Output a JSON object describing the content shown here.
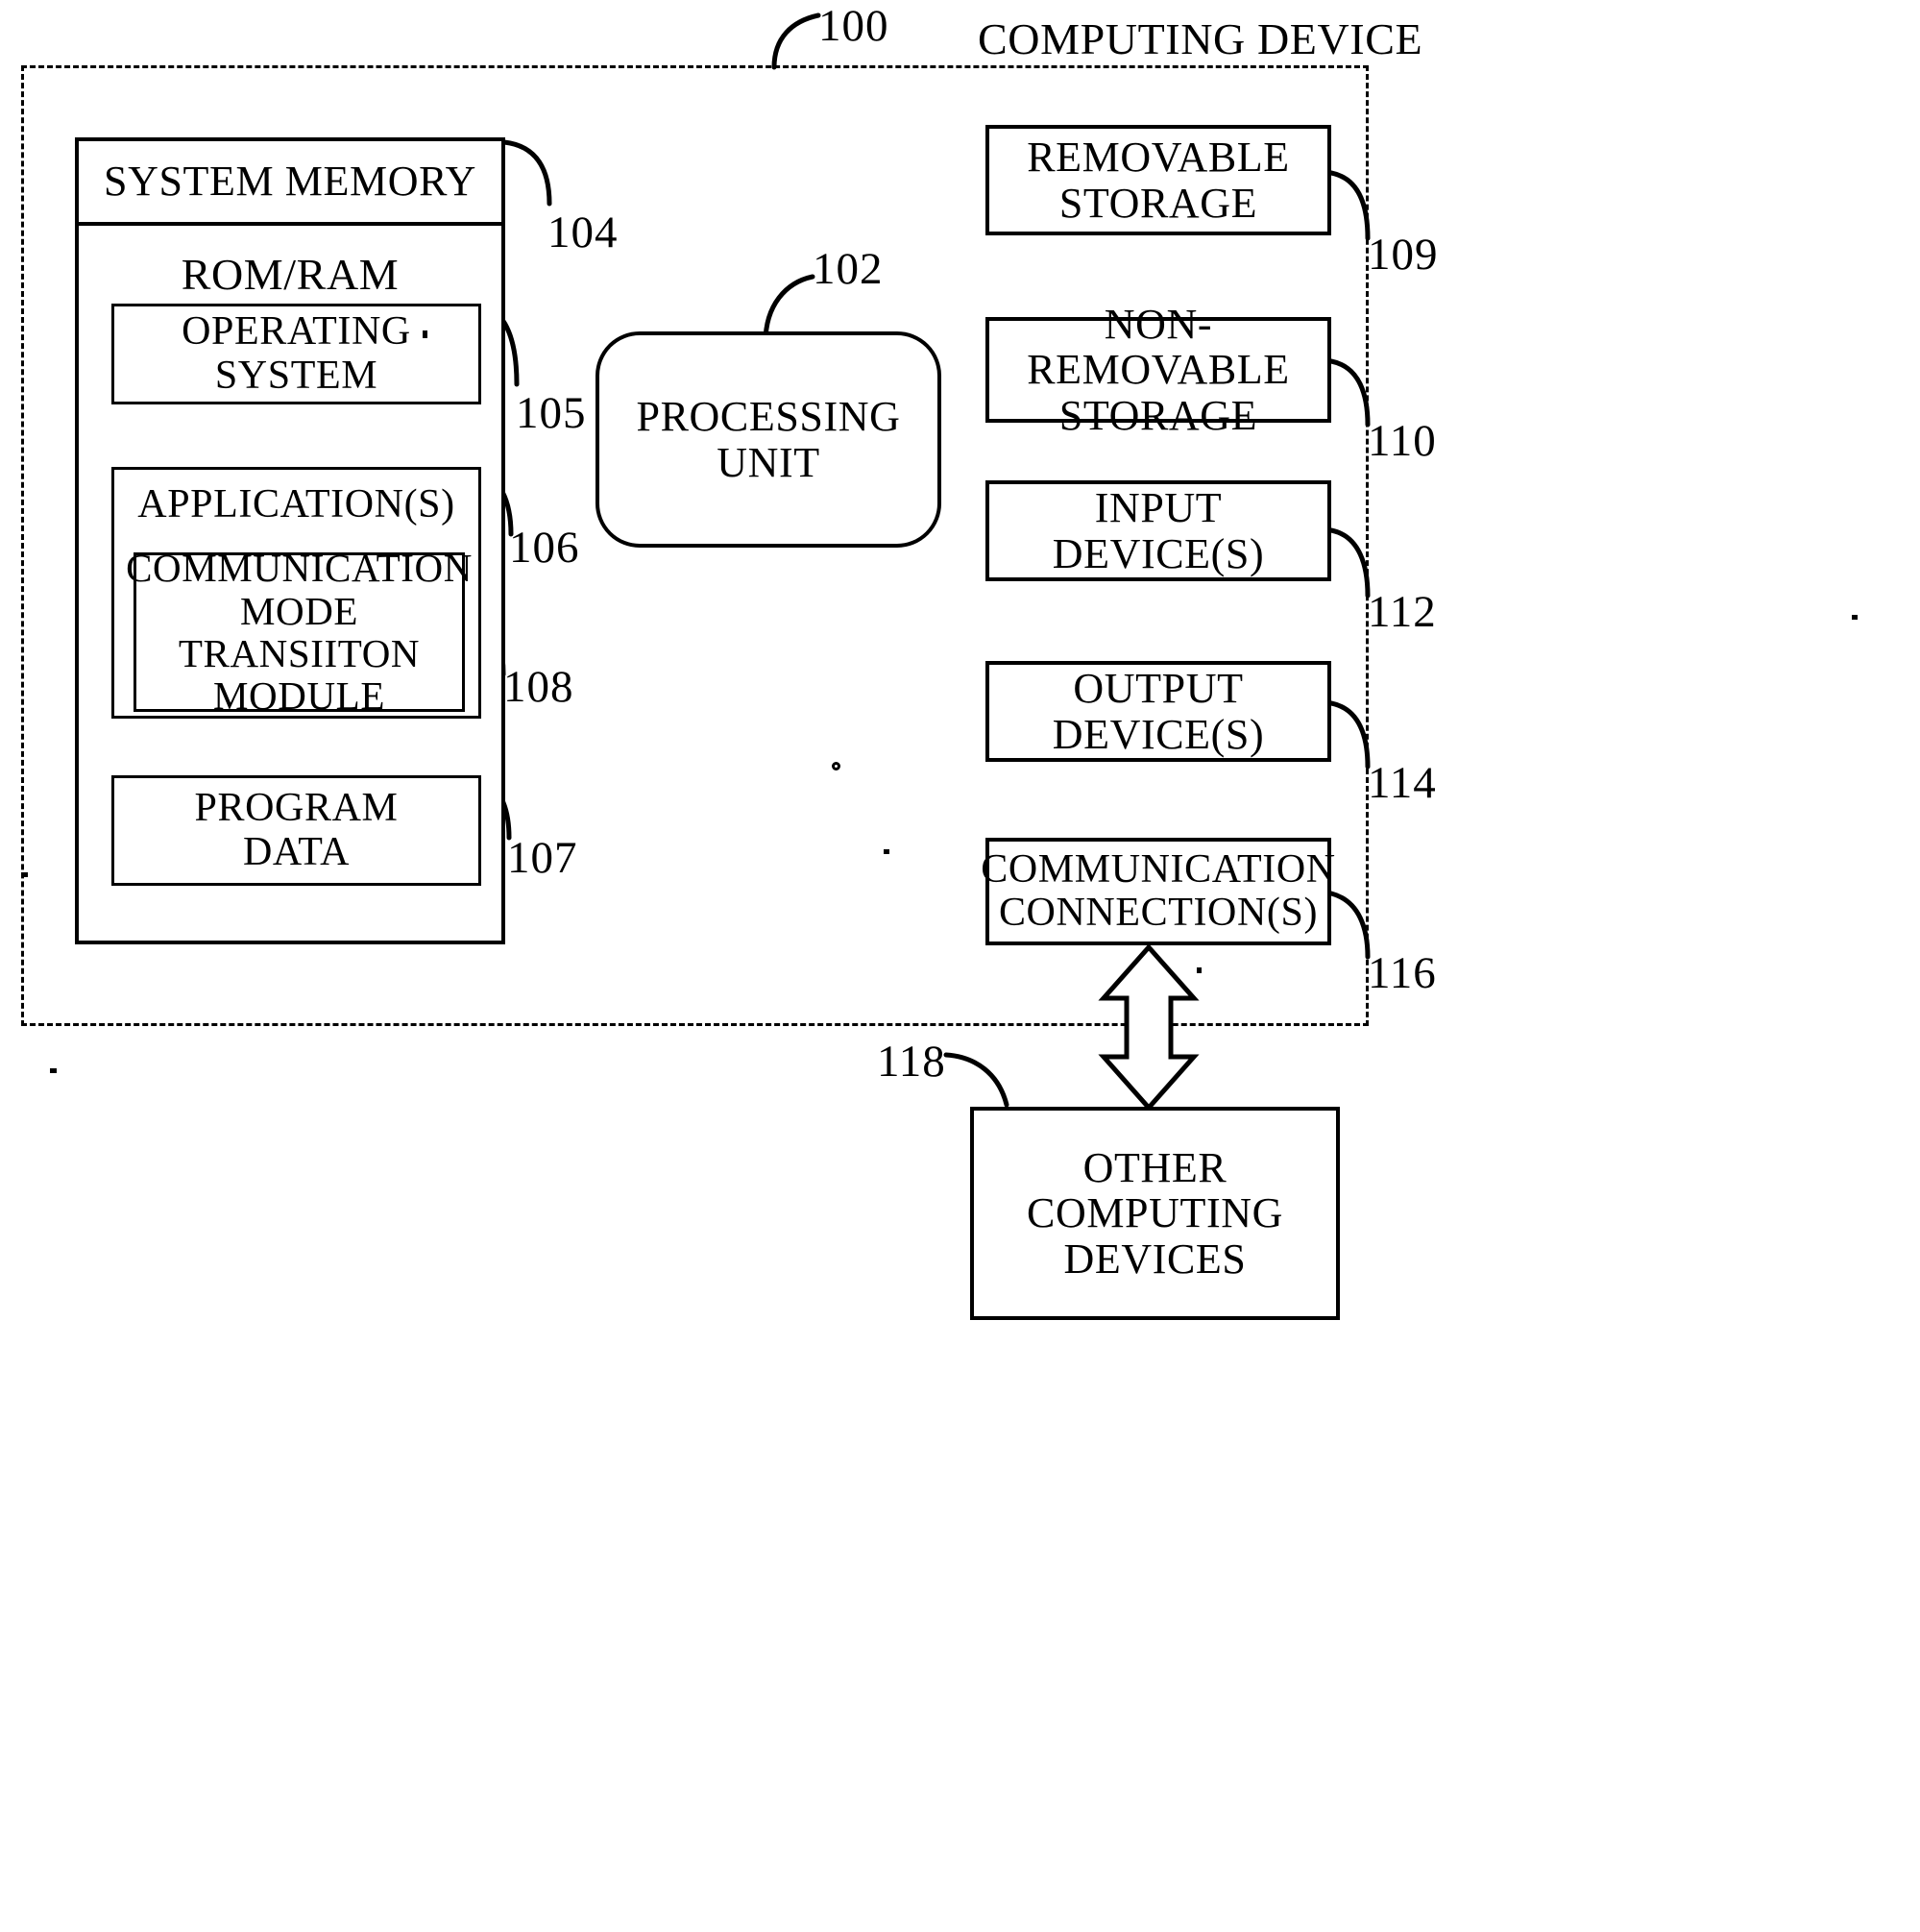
{
  "figure": {
    "title": "COMPUTING DEVICE",
    "root_ref": "100"
  },
  "boundary": {
    "label": "COMPUTING DEVICE",
    "style": "dashed"
  },
  "memory": {
    "header": "SYSTEM MEMORY",
    "header_ref": "104",
    "subheader": "ROM/RAM",
    "blocks": [
      {
        "id": "os",
        "lines": [
          "OPERATING",
          "SYSTEM"
        ],
        "ref": "105"
      },
      {
        "id": "app",
        "lines": [
          "APPLICATION(S)"
        ],
        "ref": "106"
      },
      {
        "id": "module",
        "lines": [
          "COMMUNICATION",
          "MODE TRANSIITON",
          "MODULE"
        ],
        "ref": "108"
      },
      {
        "id": "progdata",
        "lines": [
          "PROGRAM",
          "DATA"
        ],
        "ref": "107"
      }
    ]
  },
  "processing_unit": {
    "label": "PROCESSING UNIT",
    "ref": "102"
  },
  "peripherals": [
    {
      "id": "removable",
      "lines": [
        "REMOVABLE",
        "STORAGE"
      ],
      "ref": "109"
    },
    {
      "id": "non-removable",
      "lines": [
        "NON-REMOVABLE",
        "STORAGE"
      ],
      "ref": "110"
    },
    {
      "id": "input",
      "lines": [
        "INPUT DEVICE(S)"
      ],
      "ref": "112"
    },
    {
      "id": "output",
      "lines": [
        "OUTPUT DEVICE(S)"
      ],
      "ref": "114"
    },
    {
      "id": "comm",
      "lines": [
        "COMMUNICATION",
        "CONNECTION(S)"
      ],
      "ref": "116"
    }
  ],
  "external": {
    "lines": [
      "OTHER",
      "COMPUTING",
      "DEVICES"
    ],
    "ref": "118",
    "connector": "double-headed-vertical-arrow"
  },
  "colors": {
    "ink": "#000000",
    "paper": "#ffffff"
  }
}
